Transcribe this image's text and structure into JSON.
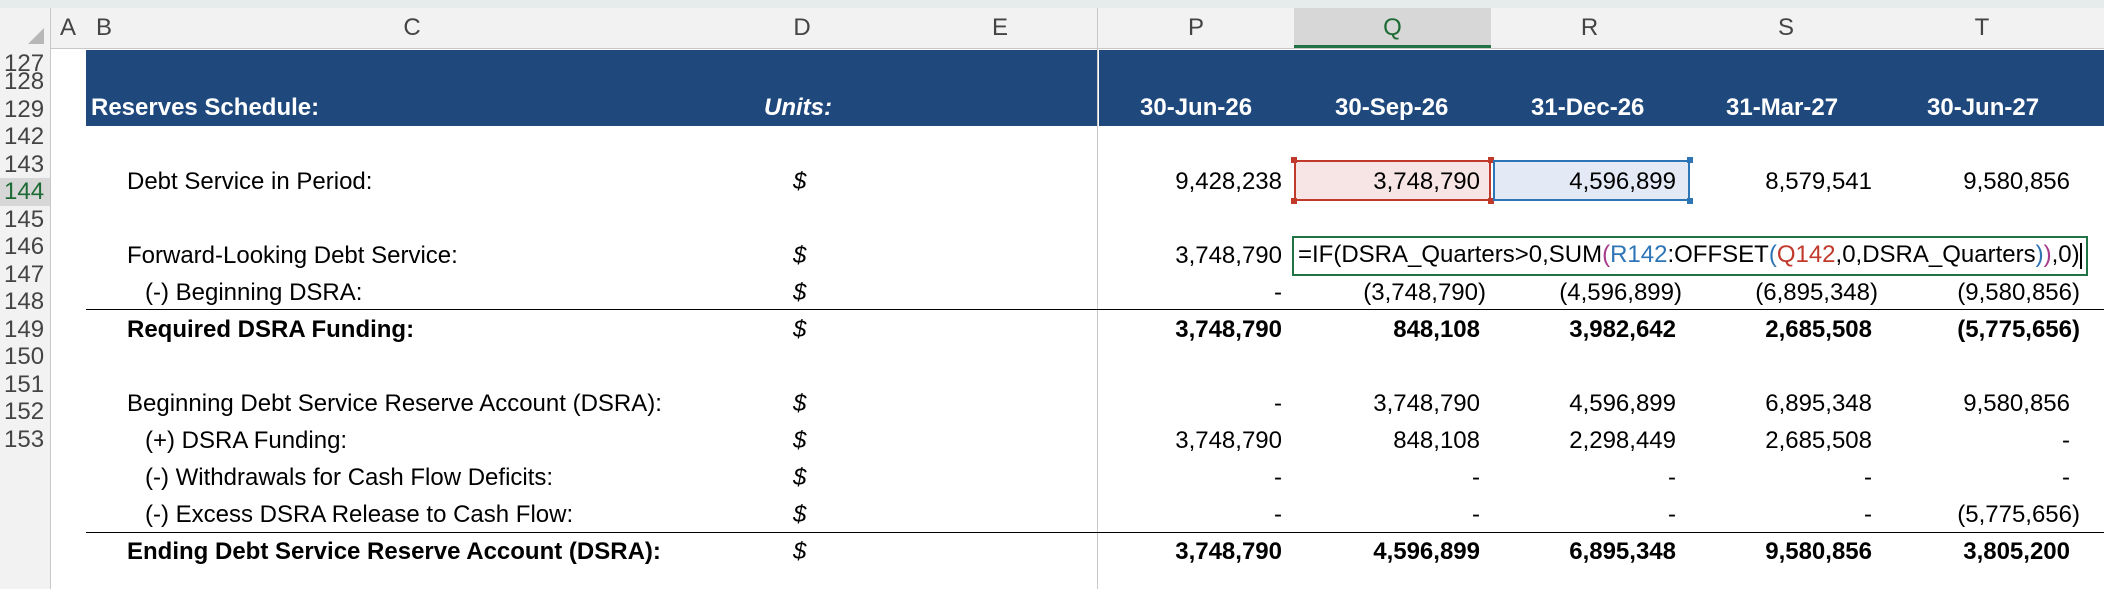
{
  "columns": [
    "A",
    "B",
    "C",
    "D",
    "E",
    "P",
    "Q",
    "R",
    "S",
    "T"
  ],
  "rows": [
    "127",
    "128",
    "129",
    "142",
    "143",
    "144",
    "145",
    "146",
    "147",
    "148",
    "149",
    "150",
    "151",
    "152",
    "153"
  ],
  "header": {
    "title": "Reserves Schedule:",
    "units": "Units:",
    "dates": [
      "30-Jun-26",
      "30-Sep-26",
      "31-Dec-26",
      "31-Mar-27",
      "30-Jun-27"
    ]
  },
  "formula": {
    "p1": "=IF(DSRA_Quarters>0,SUM",
    "o1": "(",
    "r1": "R142",
    "p2": ":OFFSET",
    "o2": "(",
    "r2": "Q142",
    "p3": ",0,DSRA_Quarters",
    "c2": ")",
    "c1": ")",
    "p4": ",0)"
  },
  "lines": [
    {
      "label": "Debt Service in Period:",
      "unit": "$",
      "values": [
        "9,428,238",
        "3,748,790",
        "4,596,899",
        "8,579,541",
        "9,580,856"
      ]
    },
    {
      "label": "Forward-Looking Debt Service:",
      "unit": "$",
      "values": [
        "3,748,790"
      ]
    },
    {
      "label": "(-) Beginning DSRA:",
      "unit": "$",
      "values": [
        "-",
        "(3,748,790)",
        "(4,596,899)",
        "(6,895,348)",
        "(9,580,856)"
      ]
    },
    {
      "label": "Required DSRA Funding:",
      "unit": "$",
      "values": [
        "3,748,790",
        "848,108",
        "3,982,642",
        "2,685,508",
        "(5,775,656)"
      ]
    },
    {
      "label": "Beginning Debt Service Reserve Account (DSRA):",
      "unit": "$",
      "values": [
        "-",
        "3,748,790",
        "4,596,899",
        "6,895,348",
        "9,580,856"
      ]
    },
    {
      "label": "(+) DSRA Funding:",
      "unit": "$",
      "values": [
        "3,748,790",
        "848,108",
        "2,298,449",
        "2,685,508",
        "-"
      ]
    },
    {
      "label": "(-) Withdrawals for Cash Flow Deficits:",
      "unit": "$",
      "values": [
        "-",
        "-",
        "-",
        "-",
        "-"
      ]
    },
    {
      "label": "(-) Excess DSRA Release to Cash Flow:",
      "unit": "$",
      "values": [
        "-",
        "-",
        "-",
        "-",
        "(5,775,656)"
      ]
    },
    {
      "label": "Ending Debt Service Reserve Account (DSRA):",
      "unit": "$",
      "values": [
        "3,748,790",
        "4,596,899",
        "6,895,348",
        "9,580,856",
        "3,805,200"
      ]
    }
  ]
}
